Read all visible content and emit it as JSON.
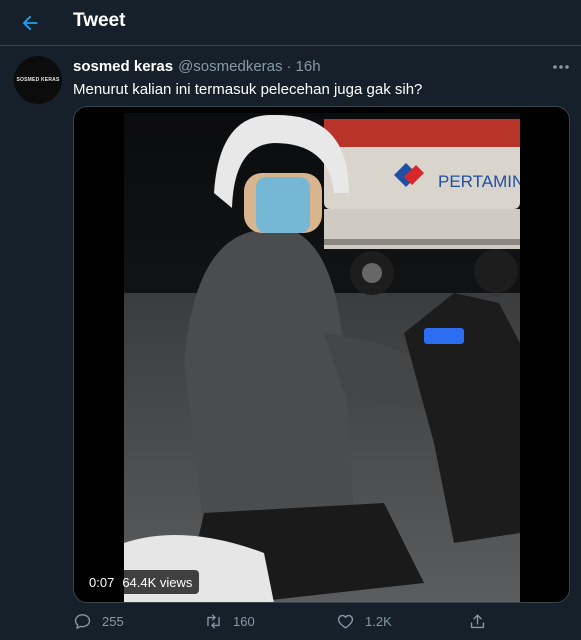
{
  "header": {
    "title": "Tweet"
  },
  "tweet": {
    "avatar_text": "SOSMED KERAS",
    "display_name": "sosmed keras",
    "handle": "@sosmedkeras",
    "separator": "·",
    "time": "16h",
    "text": "Menurut kalian ini termasuk pelecehan juga gak sih?"
  },
  "media": {
    "duration": "0:07",
    "views": "64.4K views",
    "scene_sign_text": "PERTAMIN"
  },
  "actions": {
    "reply_count": "255",
    "retweet_count": "160",
    "like_count": "1.2K"
  },
  "icons": {
    "back": "arrow-left-icon",
    "more": "more-horizontal-icon",
    "reply": "reply-icon",
    "retweet": "retweet-icon",
    "like": "heart-icon",
    "share": "share-icon"
  },
  "colors": {
    "background": "#15202b",
    "accent": "#1da1f2",
    "secondary_text": "#8899a6",
    "border": "#38444d"
  }
}
